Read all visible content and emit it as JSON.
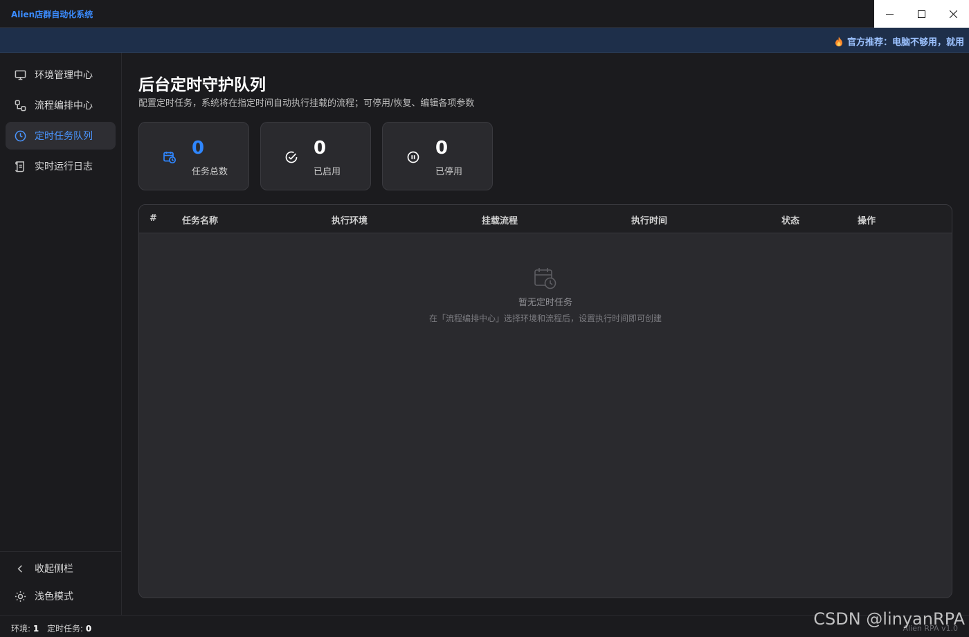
{
  "app": {
    "title": "Alien店群自动化系统"
  },
  "window_controls": {
    "minimize": "minimize-icon",
    "maximize": "maximize-icon",
    "close": "close-icon"
  },
  "banner": {
    "text": "官方推荐：电脑不够用，就用"
  },
  "sidebar": {
    "items": [
      {
        "label": "环境管理中心",
        "icon": "monitor-icon",
        "active": false
      },
      {
        "label": "流程编排中心",
        "icon": "workflow-icon",
        "active": false
      },
      {
        "label": "定时任务队列",
        "icon": "clock-icon",
        "active": true
      },
      {
        "label": "实时运行日志",
        "icon": "log-scroll-icon",
        "active": false
      }
    ],
    "collapse_label": "收起侧栏",
    "theme_label": "浅色模式"
  },
  "main": {
    "title": "后台定时守护队列",
    "subtitle": "配置定时任务，系统将在指定时间自动执行挂载的流程；可停用/恢复、编辑各项参数",
    "stats": [
      {
        "value": "0",
        "label": "任务总数",
        "icon": "calendar-clock-icon"
      },
      {
        "value": "0",
        "label": "已启用",
        "icon": "check-circle-icon"
      },
      {
        "value": "0",
        "label": "已停用",
        "icon": "pause-circle-icon"
      }
    ],
    "table": {
      "columns": [
        "#",
        "任务名称",
        "执行环境",
        "挂载流程",
        "执行时间",
        "状态",
        "操作"
      ],
      "rows": [],
      "empty_title": "暂无定时任务",
      "empty_desc": "在「流程编排中心」选择环境和流程后，设置执行时间即可创建"
    }
  },
  "statusbar": {
    "env_label": "环境:",
    "env_value": "1",
    "tasks_label": "定时任务:",
    "tasks_value": "0",
    "version": "Alien RPA v1.0"
  },
  "watermark": "CSDN @linyanRPA",
  "colors": {
    "accent": "#2f86ff",
    "banner_bg": "#1e2f4a",
    "bg": "#1b1b1e",
    "card_bg": "#2a2a2e"
  }
}
